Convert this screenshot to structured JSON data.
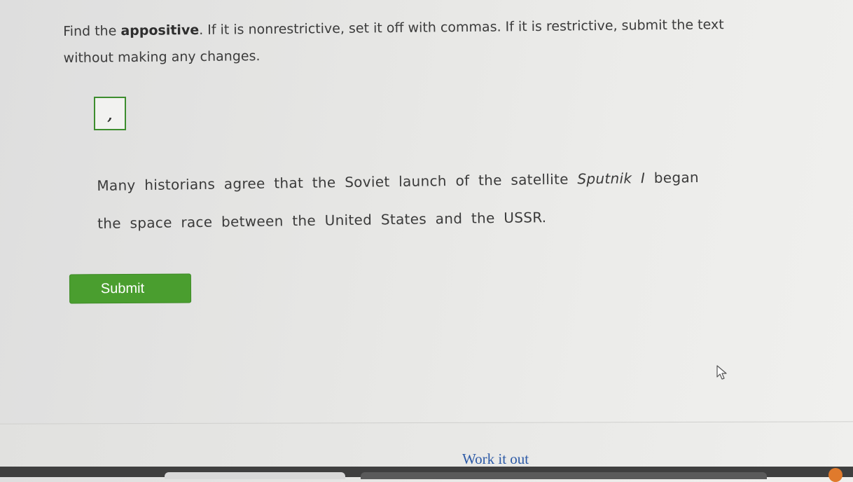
{
  "instruction": {
    "prefix": "Find the ",
    "bold_term": "appositive",
    "suffix": ". If it is nonrestrictive, set it off with commas. If it is restrictive, submit the text without making any changes."
  },
  "tiles": [
    {
      "symbol": ","
    }
  ],
  "sentence": {
    "line1": [
      {
        "text": "Many",
        "italic": false
      },
      {
        "text": "historians",
        "italic": false
      },
      {
        "text": "agree",
        "italic": false
      },
      {
        "text": "that",
        "italic": false
      },
      {
        "text": "the",
        "italic": false
      },
      {
        "text": "Soviet",
        "italic": false
      },
      {
        "text": "launch",
        "italic": false
      },
      {
        "text": "of",
        "italic": false
      },
      {
        "text": "the",
        "italic": false
      },
      {
        "text": "satellite",
        "italic": false
      },
      {
        "text": "Sputnik",
        "italic": true
      },
      {
        "text": "I",
        "italic": true
      },
      {
        "text": "began",
        "italic": false
      }
    ],
    "line2": [
      {
        "text": "the",
        "italic": false
      },
      {
        "text": "space",
        "italic": false
      },
      {
        "text": "race",
        "italic": false
      },
      {
        "text": "between",
        "italic": false
      },
      {
        "text": "the",
        "italic": false
      },
      {
        "text": "United",
        "italic": false
      },
      {
        "text": "States",
        "italic": false
      },
      {
        "text": "and",
        "italic": false
      },
      {
        "text": "the",
        "italic": false
      },
      {
        "text": "USSR",
        "italic": false
      },
      {
        "text": ".",
        "italic": false
      }
    ]
  },
  "buttons": {
    "submit_label": "Submit"
  },
  "footer": {
    "link_label": "Work it out"
  },
  "colors": {
    "accent_green": "#4a9e2f",
    "link_blue": "#2d5aa6"
  }
}
